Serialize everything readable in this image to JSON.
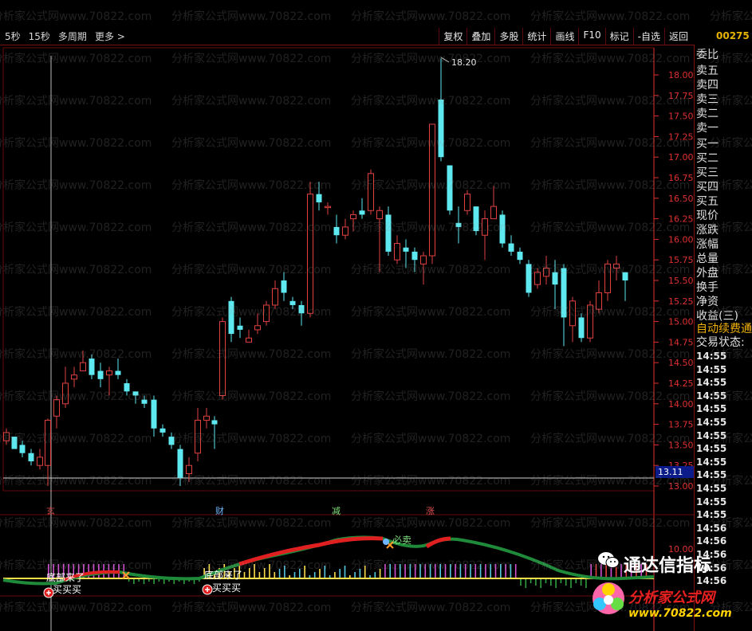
{
  "toolbar": {
    "left": [
      "5秒",
      "15秒",
      "多周期",
      "更多 >"
    ],
    "right": [
      "复权",
      "叠加",
      "多股",
      "统计",
      "画线",
      "F10",
      "标记",
      "-自选",
      "返回"
    ]
  },
  "stock_code": "00275",
  "price_axis": {
    "labels": [
      "18.00",
      "17.75",
      "17.50",
      "17.25",
      "17.00",
      "16.75",
      "16.50",
      "16.25",
      "16.00",
      "15.75",
      "15.50",
      "15.25",
      "15.00",
      "14.75",
      "14.50",
      "14.25",
      "14.00",
      "13.75",
      "13.50",
      "13.25",
      "13.00"
    ],
    "current_price": "13.11",
    "high_marker": "18.20"
  },
  "sub_axis": {
    "label": "10.00"
  },
  "markers": {
    "m1": "玄",
    "m2": "财",
    "m3": "减",
    "m4": "涨"
  },
  "signals": {
    "bottom1": "底部来了",
    "buy1": "买买买",
    "bottom2": "底部来了",
    "buy2": "买买买",
    "sell": "必卖"
  },
  "right_panel": {
    "labels": [
      "委比",
      "卖五",
      "卖四",
      "卖三",
      "卖二",
      "卖一",
      "买一",
      "买二",
      "买三",
      "买四",
      "买五",
      "现价",
      "涨跌",
      "涨幅",
      "总量",
      "外盘",
      "换手",
      "净资",
      "收益(三)"
    ],
    "auto_fee": "自动续费通",
    "trade_status": "交易状态:",
    "times": [
      "14:55",
      "14:55",
      "14:55",
      "14:55",
      "14:55",
      "14:55",
      "14:55",
      "14:55",
      "14:55",
      "14:55",
      "14:55",
      "14:55",
      "14:55",
      "14:56",
      "14:56",
      "14:56",
      "14:56",
      "14:56"
    ]
  },
  "brand": {
    "wechat": "通达信指标",
    "site_name": "分析家公式网",
    "url": "www.70822.com"
  },
  "watermark": "分析家公式网www.70822.com",
  "colors": {
    "up": "#e04040",
    "down": "#5ee8ef",
    "axis": "#e03030",
    "grid": "#6a0a0a"
  }
}
